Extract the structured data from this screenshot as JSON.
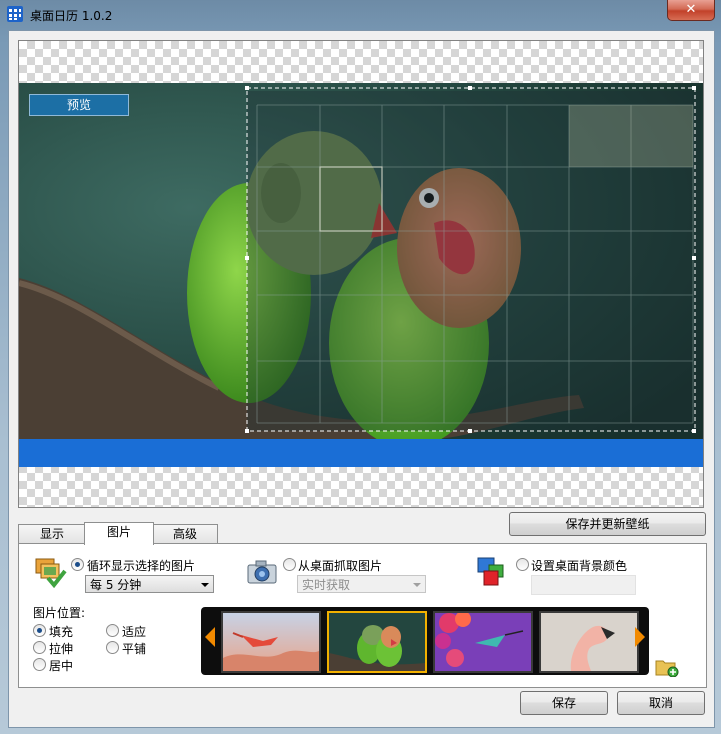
{
  "window": {
    "title": "桌面日历 1.0.2",
    "close_glyph": "✕"
  },
  "preview": {
    "label": "预览"
  },
  "tabs": [
    {
      "label": "显示"
    },
    {
      "label": "图片"
    },
    {
      "label": "高级"
    }
  ],
  "save_update_button": "保存并更新壁纸",
  "picture_tab": {
    "cycle_option": "循环显示选择的图片",
    "cycle_interval": "每 5 分钟",
    "capture_option": "从桌面抓取图片",
    "capture_mode": "实时获取",
    "bg_color_option": "设置桌面背景颜色",
    "position_label": "图片位置:",
    "positions": [
      {
        "label": "填充",
        "checked": true
      },
      {
        "label": "适应",
        "checked": false
      },
      {
        "label": "拉伸",
        "checked": false
      },
      {
        "label": "平铺",
        "checked": false
      },
      {
        "label": "居中",
        "checked": false
      }
    ],
    "selected_source": "cycle"
  },
  "thumbnails": [
    {
      "name": "flamingo-flying",
      "selected": false
    },
    {
      "name": "lovebirds",
      "selected": true
    },
    {
      "name": "hummingbird",
      "selected": false
    },
    {
      "name": "flamingo-head",
      "selected": false
    }
  ],
  "footer": {
    "save": "保存",
    "cancel": "取消"
  },
  "colors": {
    "accent_blue": "#1a6ed6",
    "selection_orange": "#f2b100",
    "strip_arrow": "#f28a00"
  }
}
